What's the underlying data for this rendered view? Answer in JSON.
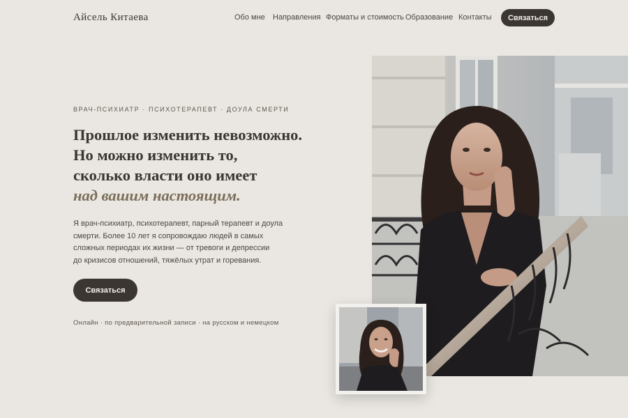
{
  "brand": {
    "name": "Айсель Китаева"
  },
  "nav": {
    "items": [
      {
        "label": "Обо мне"
      },
      {
        "label": "Направления"
      },
      {
        "label": "Форматы и стоимость"
      },
      {
        "label": "Образование"
      },
      {
        "label": "Контакты"
      }
    ],
    "cta_label": "Связаться"
  },
  "hero": {
    "eyebrow": "ВРАЧ-ПСИХИАТР  ·  ПСИХОТЕРАПЕВТ  ·  ДОУЛА СМЕРТИ",
    "headline": [
      "Прошлое изменить невозможно.",
      "Но можно изменить то,",
      "сколько власти оно имеет"
    ],
    "headline_accent": "над вашим настоящим.",
    "intro": [
      "Я врач-психиатр, психотерапевт, парный терапевт и доула",
      "смерти. Более 10 лет я сопровождаю людей в самых",
      "сложных периодах их жизни — от тревоги и депрессии",
      "до кризисов отношений, тяжёлых утрат и горевания."
    ],
    "cta_label": "Связаться",
    "meta": "Онлайн  ·  по предварительной записи  ·  на русском и немецком"
  },
  "colors": {
    "background": "#eae7e2",
    "text": "#3b3631",
    "button": "#3b3631",
    "accent": "#7b6d59"
  },
  "images": {
    "main_photo": "portrait-woman-on-balcony-photo",
    "small_photo": "portrait-woman-smiling-photo"
  }
}
